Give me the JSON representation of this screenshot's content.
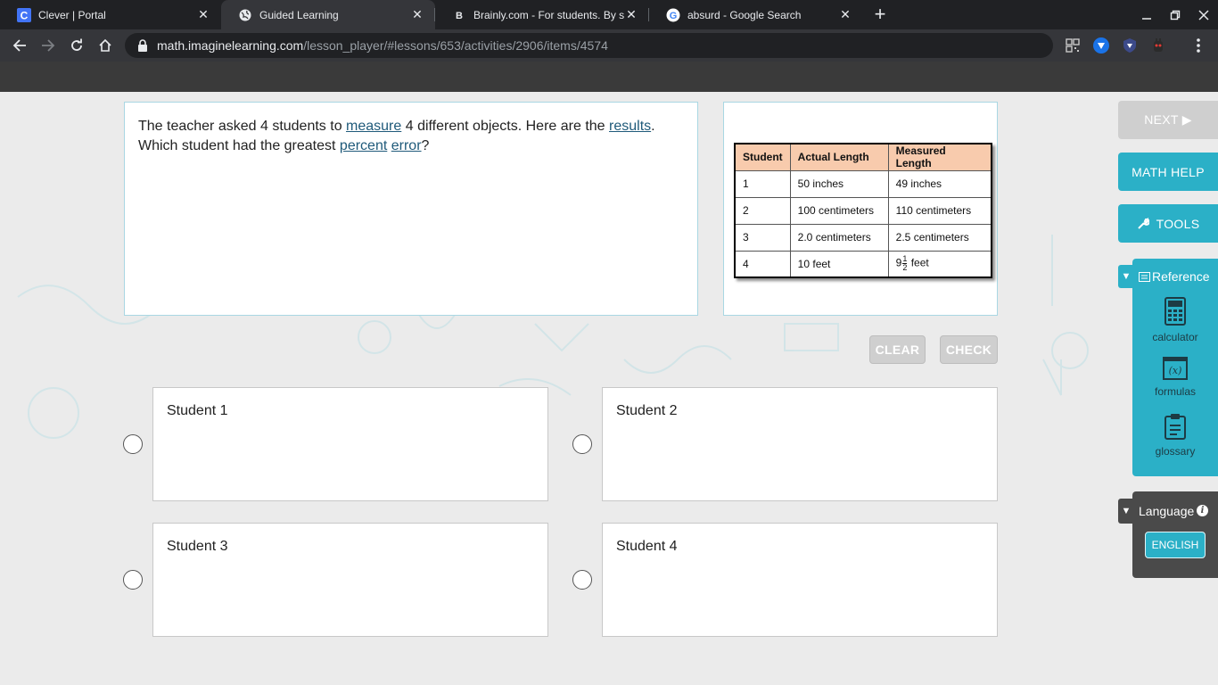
{
  "browser": {
    "tabs": [
      {
        "title": "Clever | Portal",
        "icon": "clever-icon"
      },
      {
        "title": "Guided Learning",
        "icon": "globe-icon",
        "active": true
      },
      {
        "title": "Brainly.com - For students. By st",
        "icon": "brainly-icon"
      },
      {
        "title": "absurd - Google Search",
        "icon": "google-icon"
      }
    ],
    "new_tab": "+",
    "url_host": "math.imaginelearning.com",
    "url_path": "/lesson_player/#lessons/653/activities/2906/items/4574"
  },
  "question": {
    "text_1": "The teacher asked 4 students to ",
    "link_measure": "measure",
    "text_2": " 4 different objects. Here are the ",
    "link_results": "results",
    "text_3": ".",
    "text_4": "Which student had the greatest ",
    "link_percent": "percent",
    "text_5": " ",
    "link_error": "error",
    "text_6": "?"
  },
  "table": {
    "headers": [
      "Student",
      "Actual Length",
      "Measured Length"
    ],
    "rows": [
      [
        "1",
        "50 inches",
        "49 inches"
      ],
      [
        "2",
        "100 centimeters",
        "110 centimeters"
      ],
      [
        "3",
        "2.0 centimeters",
        "2.5 centimeters"
      ],
      [
        "4",
        "10 feet",
        "9 1/2 feet"
      ]
    ],
    "row4_measured": {
      "whole": "9",
      "num": "1",
      "den": "2",
      "unit": " feet"
    }
  },
  "actions": {
    "clear": "CLEAR",
    "check": "CHECK"
  },
  "choices": [
    {
      "label": "Student 1"
    },
    {
      "label": "Student 2"
    },
    {
      "label": "Student 3"
    },
    {
      "label": "Student 4"
    }
  ],
  "side": {
    "next": "NEXT ▶",
    "math_help": "MATH HELP",
    "tools": "TOOLS",
    "reference_title": "Reference",
    "reference_items": [
      "calculator",
      "formulas",
      "glossary"
    ],
    "language_title": "Language",
    "language_button": "ENGLISH"
  },
  "colors": {
    "teal": "#2bb0c7",
    "disabled": "#cfcfcf",
    "header_peach": "#f8cbad",
    "link": "#1f5a7a"
  }
}
